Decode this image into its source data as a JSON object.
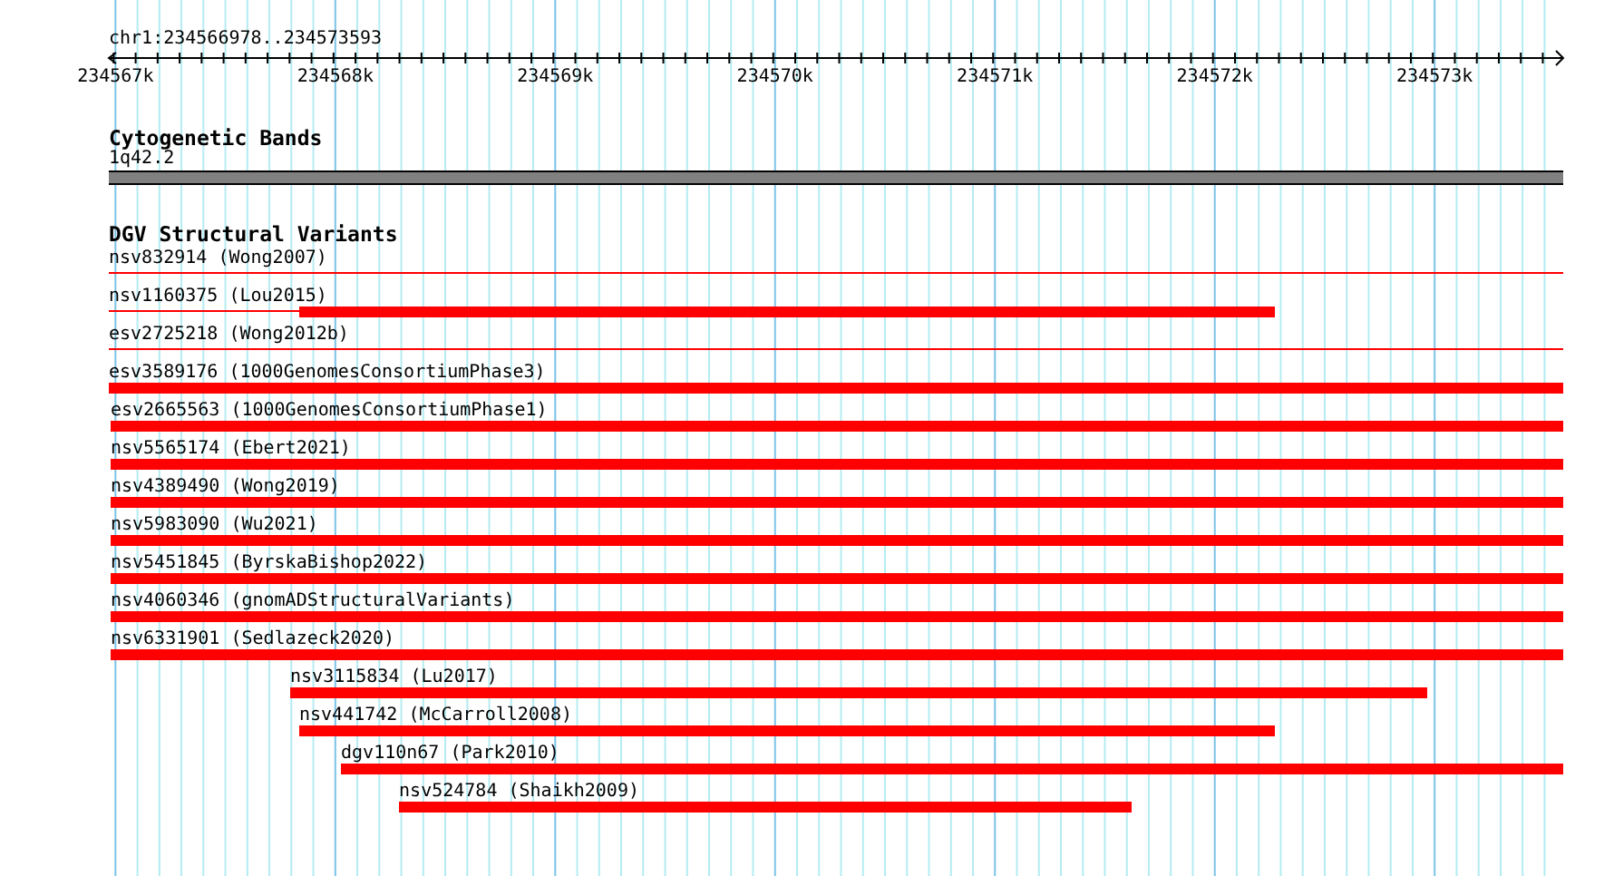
{
  "ruler": {
    "title": "chr1:234566978..234573593",
    "ticks": [
      {
        "label": "234567k"
      },
      {
        "label": "234568k"
      },
      {
        "label": "234569k"
      },
      {
        "label": "234570k"
      },
      {
        "label": "234571k"
      },
      {
        "label": "234572k"
      },
      {
        "label": "234573k"
      }
    ]
  },
  "cytogenetic_bands": {
    "title": "Cytogenetic Bands",
    "band": {
      "name": "1q42.2",
      "color": "#808080"
    }
  },
  "dgv_structural_variants": {
    "title": "DGV Structural Variants",
    "features": [
      {
        "name": "nsv832914 (Wong2007)",
        "kind": "thin"
      },
      {
        "name": "nsv1160375 (Lou2015)",
        "kind": "mixed"
      },
      {
        "name": "esv2725218 (Wong2012b)",
        "kind": "thin"
      },
      {
        "name": "esv3589176 (1000GenomesConsortiumPhase3)",
        "kind": "thick"
      },
      {
        "name": "esv2665563 (1000GenomesConsortiumPhase1)",
        "kind": "thick"
      },
      {
        "name": "nsv5565174 (Ebert2021)",
        "kind": "thick"
      },
      {
        "name": "nsv4389490 (Wong2019)",
        "kind": "thick"
      },
      {
        "name": "nsv5983090 (Wu2021)",
        "kind": "thick"
      },
      {
        "name": "nsv5451845 (ByrskaBishop2022)",
        "kind": "thick"
      },
      {
        "name": "nsv4060346 (gnomADStructuralVariants)",
        "kind": "thick"
      },
      {
        "name": "nsv6331901 (Sedlazeck2020)",
        "kind": "thick"
      },
      {
        "name": "nsv3115834 (Lu2017)",
        "kind": "thick"
      },
      {
        "name": "nsv441742 (McCarroll2008)",
        "kind": "thick"
      },
      {
        "name": "dgv110n67 (Park2010)",
        "kind": "thick"
      },
      {
        "name": "nsv524784 (Shaikh2009)",
        "kind": "thick"
      }
    ]
  }
}
